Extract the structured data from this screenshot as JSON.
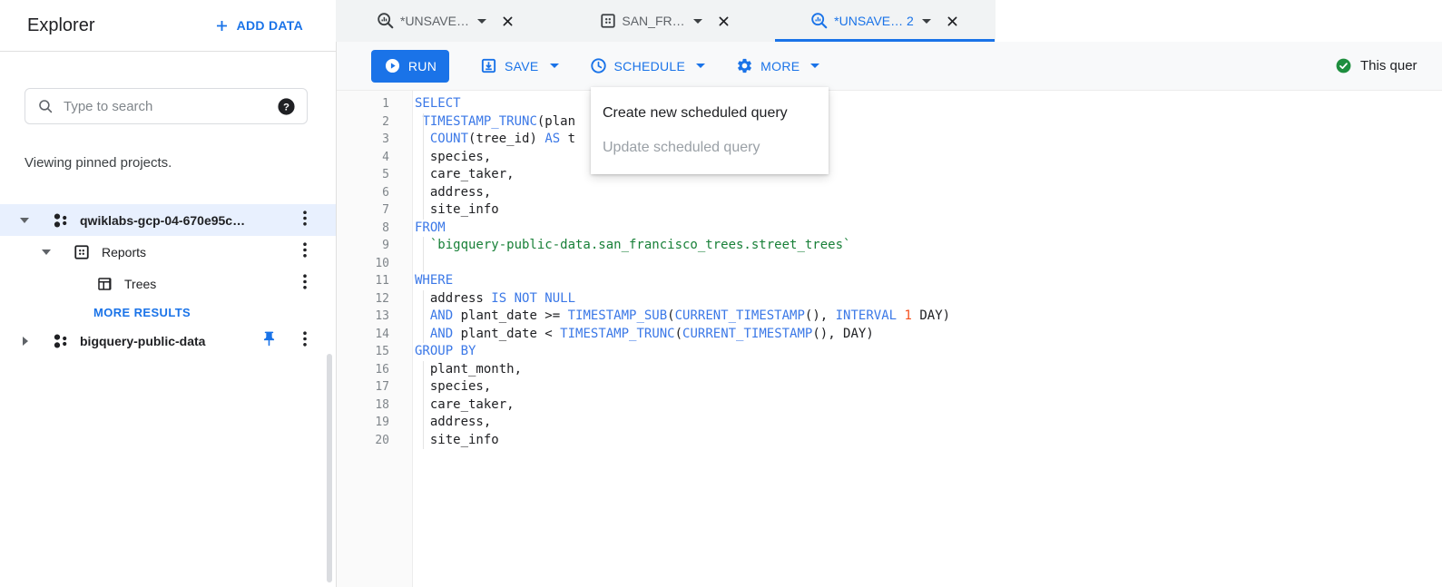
{
  "colors": {
    "accent": "#1a73e8",
    "kw": "#3b78e7",
    "str": "#188038",
    "num": "#f4511e",
    "green": "#1e8e3e"
  },
  "sidebar": {
    "title": "Explorer",
    "add_data_label": "ADD DATA",
    "search": {
      "placeholder": "Type to search"
    },
    "note": "Viewing pinned projects.",
    "tree": {
      "project1": "qwiklabs-gcp-04-670e95c…",
      "dataset1": "Reports",
      "table1": "Trees",
      "more_results": "MORE RESULTS",
      "project2": "bigquery-public-data"
    }
  },
  "tabs": [
    {
      "label": "*UNSAVE…",
      "icon": "query-icon",
      "active": false
    },
    {
      "label": "SAN_FR…",
      "icon": "dataset-icon",
      "active": false
    },
    {
      "label": "*UNSAVE… 2",
      "icon": "query-icon",
      "active": true
    }
  ],
  "toolbar": {
    "run_label": "RUN",
    "save_label": "SAVE",
    "schedule_label": "SCHEDULE",
    "more_label": "MORE",
    "status_text": "This quer"
  },
  "schedule_menu": {
    "items": [
      {
        "label": "Create new scheduled query",
        "enabled": true
      },
      {
        "label": "Update scheduled query",
        "enabled": false
      }
    ]
  },
  "editor": {
    "lines": [
      [
        [
          "kw",
          "SELECT"
        ]
      ],
      [
        [
          "pl",
          " "
        ],
        [
          "kw",
          "TIMESTAMP_TRUNC"
        ],
        [
          "pl",
          "(plan"
        ]
      ],
      [
        [
          "pl",
          "  "
        ],
        [
          "kw",
          "COUNT"
        ],
        [
          "pl",
          "(tree_id) "
        ],
        [
          "kw",
          "AS"
        ],
        [
          "pl",
          " t"
        ]
      ],
      [
        [
          "pl",
          "  species,"
        ]
      ],
      [
        [
          "pl",
          "  care_taker,"
        ]
      ],
      [
        [
          "pl",
          "  address,"
        ]
      ],
      [
        [
          "pl",
          "  site_info"
        ]
      ],
      [
        [
          "kw",
          "FROM"
        ]
      ],
      [
        [
          "pl",
          "  "
        ],
        [
          "str",
          "`bigquery-public-data.san_francisco_trees.street_trees`"
        ]
      ],
      [
        [
          "pl",
          "  "
        ]
      ],
      [
        [
          "kw",
          "WHERE"
        ]
      ],
      [
        [
          "pl",
          "  address "
        ],
        [
          "kw",
          "IS NOT NULL"
        ]
      ],
      [
        [
          "pl",
          "  "
        ],
        [
          "kw",
          "AND"
        ],
        [
          "pl",
          " plant_date >= "
        ],
        [
          "kw",
          "TIMESTAMP_SUB"
        ],
        [
          "pl",
          "("
        ],
        [
          "kw",
          "CURRENT_TIMESTAMP"
        ],
        [
          "pl",
          "(), "
        ],
        [
          "kw",
          "INTERVAL"
        ],
        [
          "pl",
          " "
        ],
        [
          "num",
          "1"
        ],
        [
          "pl",
          " DAY)"
        ]
      ],
      [
        [
          "pl",
          "  "
        ],
        [
          "kw",
          "AND"
        ],
        [
          "pl",
          " plant_date < "
        ],
        [
          "kw",
          "TIMESTAMP_TRUNC"
        ],
        [
          "pl",
          "("
        ],
        [
          "kw",
          "CURRENT_TIMESTAMP"
        ],
        [
          "pl",
          "(), DAY)"
        ]
      ],
      [
        [
          "kw",
          "GROUP BY"
        ]
      ],
      [
        [
          "pl",
          "  plant_month,"
        ]
      ],
      [
        [
          "pl",
          "  species,"
        ]
      ],
      [
        [
          "pl",
          "  care_taker,"
        ]
      ],
      [
        [
          "pl",
          "  address,"
        ]
      ],
      [
        [
          "pl",
          "  site_info"
        ]
      ]
    ]
  }
}
